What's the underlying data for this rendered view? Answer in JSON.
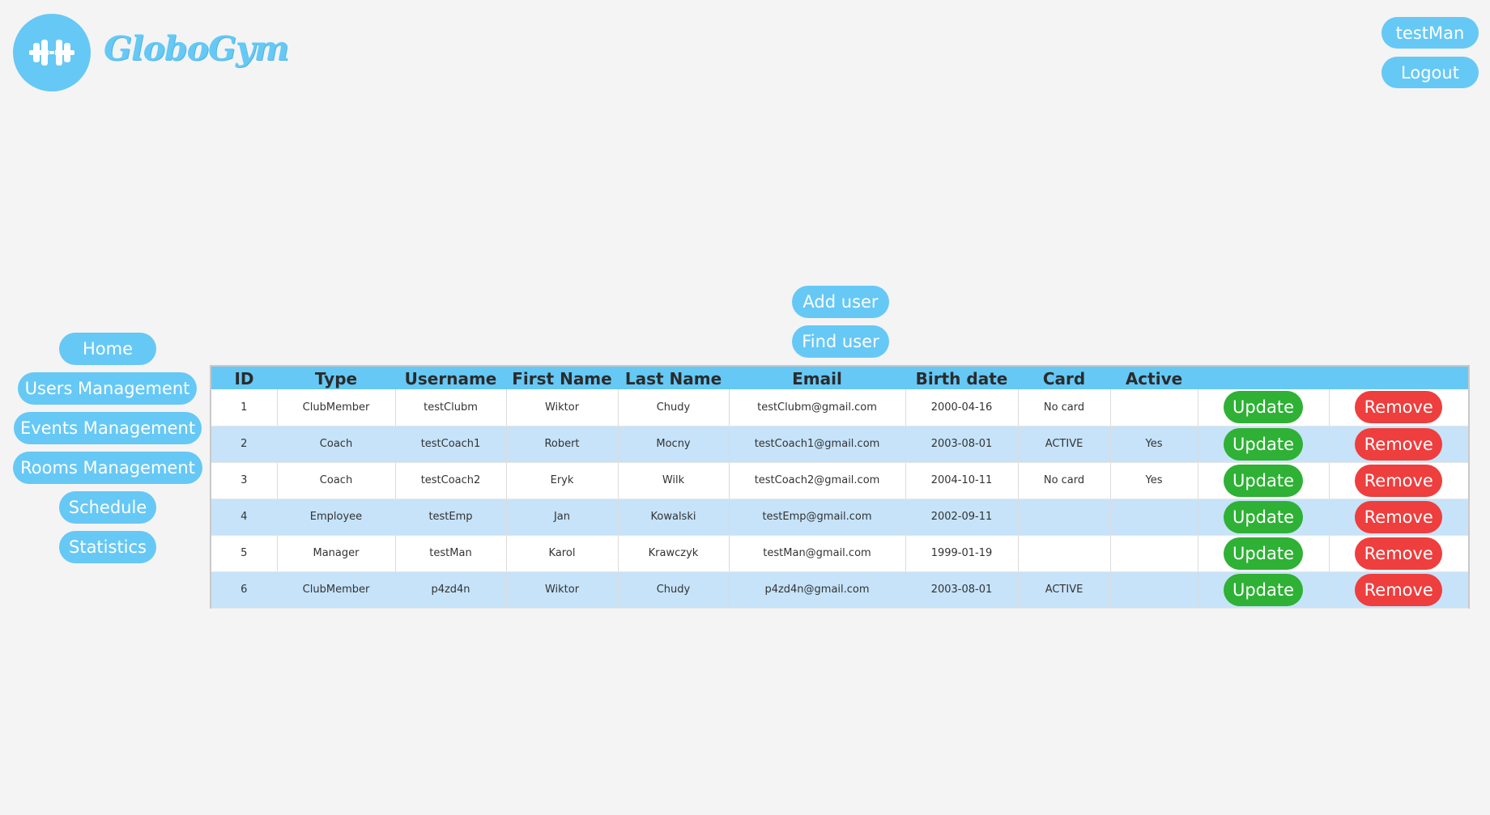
{
  "brand": {
    "name": "GloboGym",
    "logo_icon": "dumbbell-icon",
    "color": "#66c8f5"
  },
  "user_menu": {
    "username": "testMan",
    "logout_label": "Logout"
  },
  "sidebar": {
    "items": [
      {
        "label": "Home"
      },
      {
        "label": "Users Management"
      },
      {
        "label": "Events Management"
      },
      {
        "label": "Rooms Management"
      },
      {
        "label": "Schedule"
      },
      {
        "label": "Statistics"
      }
    ]
  },
  "actions": {
    "add_user_label": "Add user",
    "find_user_label": "Find user"
  },
  "table": {
    "columns": [
      "ID",
      "Type",
      "Username",
      "First Name",
      "Last Name",
      "Email",
      "Birth date",
      "Card",
      "Active",
      "",
      ""
    ],
    "update_label": "Update",
    "remove_label": "Remove",
    "rows": [
      {
        "id": "1",
        "type": "ClubMember",
        "username": "testClubm",
        "first_name": "Wiktor",
        "last_name": "Chudy",
        "email": "testClubm@gmail.com",
        "birth_date": "2000-04-16",
        "card": "No card",
        "active": ""
      },
      {
        "id": "2",
        "type": "Coach",
        "username": "testCoach1",
        "first_name": "Robert",
        "last_name": "Mocny",
        "email": "testCoach1@gmail.com",
        "birth_date": "2003-08-01",
        "card": "ACTIVE",
        "active": "Yes"
      },
      {
        "id": "3",
        "type": "Coach",
        "username": "testCoach2",
        "first_name": "Eryk",
        "last_name": "Wilk",
        "email": "testCoach2@gmail.com",
        "birth_date": "2004-10-11",
        "card": "No card",
        "active": "Yes"
      },
      {
        "id": "4",
        "type": "Employee",
        "username": "testEmp",
        "first_name": "Jan",
        "last_name": "Kowalski",
        "email": "testEmp@gmail.com",
        "birth_date": "2002-09-11",
        "card": "",
        "active": ""
      },
      {
        "id": "5",
        "type": "Manager",
        "username": "testMan",
        "first_name": "Karol",
        "last_name": "Krawczyk",
        "email": "testMan@gmail.com",
        "birth_date": "1999-01-19",
        "card": "",
        "active": ""
      },
      {
        "id": "6",
        "type": "ClubMember",
        "username": "p4zd4n",
        "first_name": "Wiktor",
        "last_name": "Chudy",
        "email": "p4zd4n@gmail.com",
        "birth_date": "2003-08-01",
        "card": "ACTIVE",
        "active": ""
      }
    ]
  },
  "colors": {
    "accent": "#66c8f5",
    "row_alt": "#c6e3f9",
    "update": "#2eb135",
    "remove": "#ee3e3e",
    "background": "#f4f4f4"
  }
}
